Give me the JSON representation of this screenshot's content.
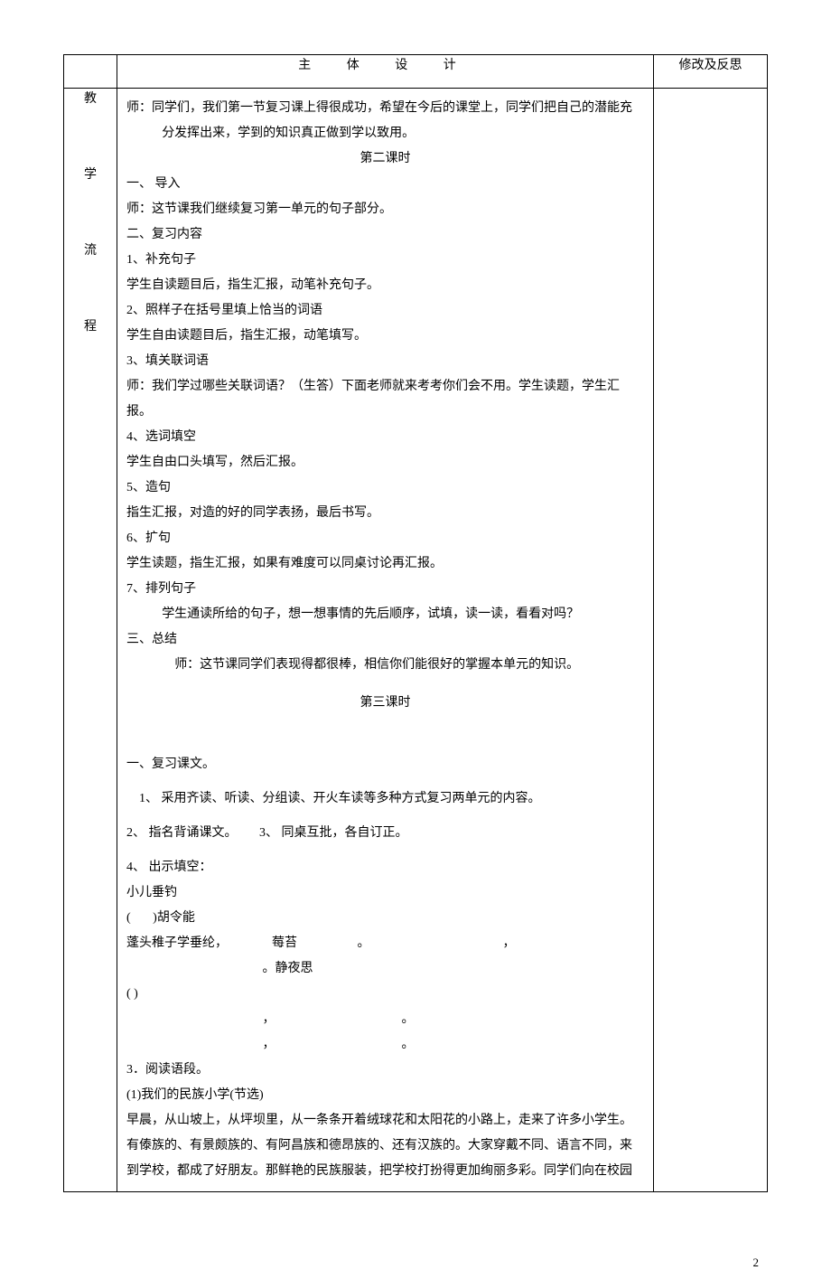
{
  "header": {
    "title": "主   体   设   计",
    "right": "修改及反思"
  },
  "leftColumn": {
    "c1": "教",
    "c2": "学",
    "c3": "流",
    "c4": "程"
  },
  "intro": {
    "line1": "师：同学们，我们第一节复习课上得很成功，希望在今后的课堂上，同学们把自己的潜能充",
    "line1b": "分发挥出来，学到的知识真正做到学以致用。"
  },
  "lesson2": {
    "title": "第二课时",
    "s1_h": "一、 导入",
    "s1_p": "师：这节课我们继续复习第一单元的句子部分。",
    "s2_h": "二、复习内容",
    "i1_h": "1、补充句子",
    "i1_p": "学生自读题目后，指生汇报，动笔补充句子。",
    "i2_h": "2、照样子在括号里填上恰当的词语",
    "i2_p": "学生自由读题目后，指生汇报，动笔填写。",
    "i3_h": "3、填关联词语",
    "i3_p": "师：我们学过哪些关联词语？（生答）下面老师就来考考你们会不用。学生读题，学生汇报。",
    "i4_h": "4、选词填空",
    "i4_p": "学生自由口头填写，然后汇报。",
    "i5_h": "5、造句",
    "i5_p": "指生汇报，对造的好的同学表扬，最后书写。",
    "i6_h": "6、扩句",
    "i6_p": "学生读题，指生汇报，如果有难度可以同桌讨论再汇报。",
    "i7_h": "7、排列句子",
    "i7_p": "学生通读所给的句子，想一想事情的先后顺序，试填，读一读，看看对吗？",
    "s3_h": "三、总结",
    "s3_p": "师：这节课同学们表现得都很棒，相信你们能很好的掌握本单元的知识。"
  },
  "lesson3": {
    "title": "第三课时",
    "s1_h": "一、复习课文。",
    "i1": "1、 采用齐读、听读、分组读、开火车读等多种方式复习两单元的内容。",
    "i2a": "2、 指名背诵课文。",
    "i2b": "3、 同桌互批，各自订正。",
    "i4_h": "4、 出示填空：",
    "poem1_title": "小儿垂钓",
    "poem1_author_pre": "(",
    "poem1_author_post": ")胡令能",
    "poem1_l1a": "蓬头稚子学垂纶，",
    "poem1_l1b": "莓苔",
    "poem2_title": "静夜思",
    "poem2_paren": "(         )",
    "s3_h": "3．阅读语段。",
    "s3_sub": "(1)我们的民族小学(节选)",
    "s3_p1": "早晨，从山坡上，从坪坝里，从一条条开着绒球花和太阳花的小路上，走来了许多小学生。",
    "s3_p2": "有傣族的、有景颇族的、有阿昌族和德昂族的、还有汉族的。大家穿戴不同、语言不同，来",
    "s3_p3": "到学校，都成了好朋友。那鲜艳的民族服装，把学校打扮得更加绚丽多彩。同学们向在校园"
  },
  "pageNumber": "2"
}
